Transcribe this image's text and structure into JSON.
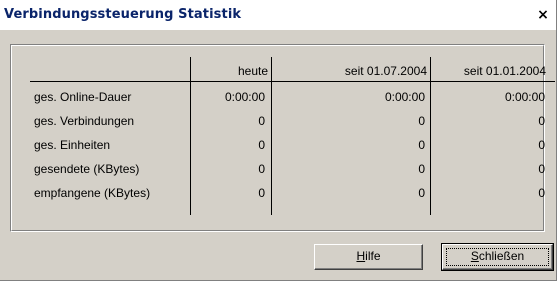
{
  "window": {
    "title": "Verbindungssteuerung Statistik",
    "close_glyph": "×"
  },
  "table": {
    "columns": [
      "heute",
      "seit 01.07.2004",
      "seit 01.01.2004"
    ],
    "rows": [
      {
        "label": "ges. Online-Dauer",
        "values": [
          "0:00:00",
          "0:00:00",
          "0:00:00"
        ]
      },
      {
        "label": "ges. Verbindungen",
        "values": [
          "0",
          "0",
          "0"
        ]
      },
      {
        "label": "ges. Einheiten",
        "values": [
          "0",
          "0",
          "0"
        ]
      },
      {
        "label": "gesendete (KBytes)",
        "values": [
          "0",
          "0",
          "0"
        ]
      },
      {
        "label": "empfangene (KBytes)",
        "values": [
          "0",
          "0",
          "0"
        ]
      }
    ]
  },
  "buttons": {
    "help": {
      "mnemonic": "H",
      "rest": "ilfe"
    },
    "close": {
      "mnemonic": "S",
      "rest": "chließen"
    }
  }
}
